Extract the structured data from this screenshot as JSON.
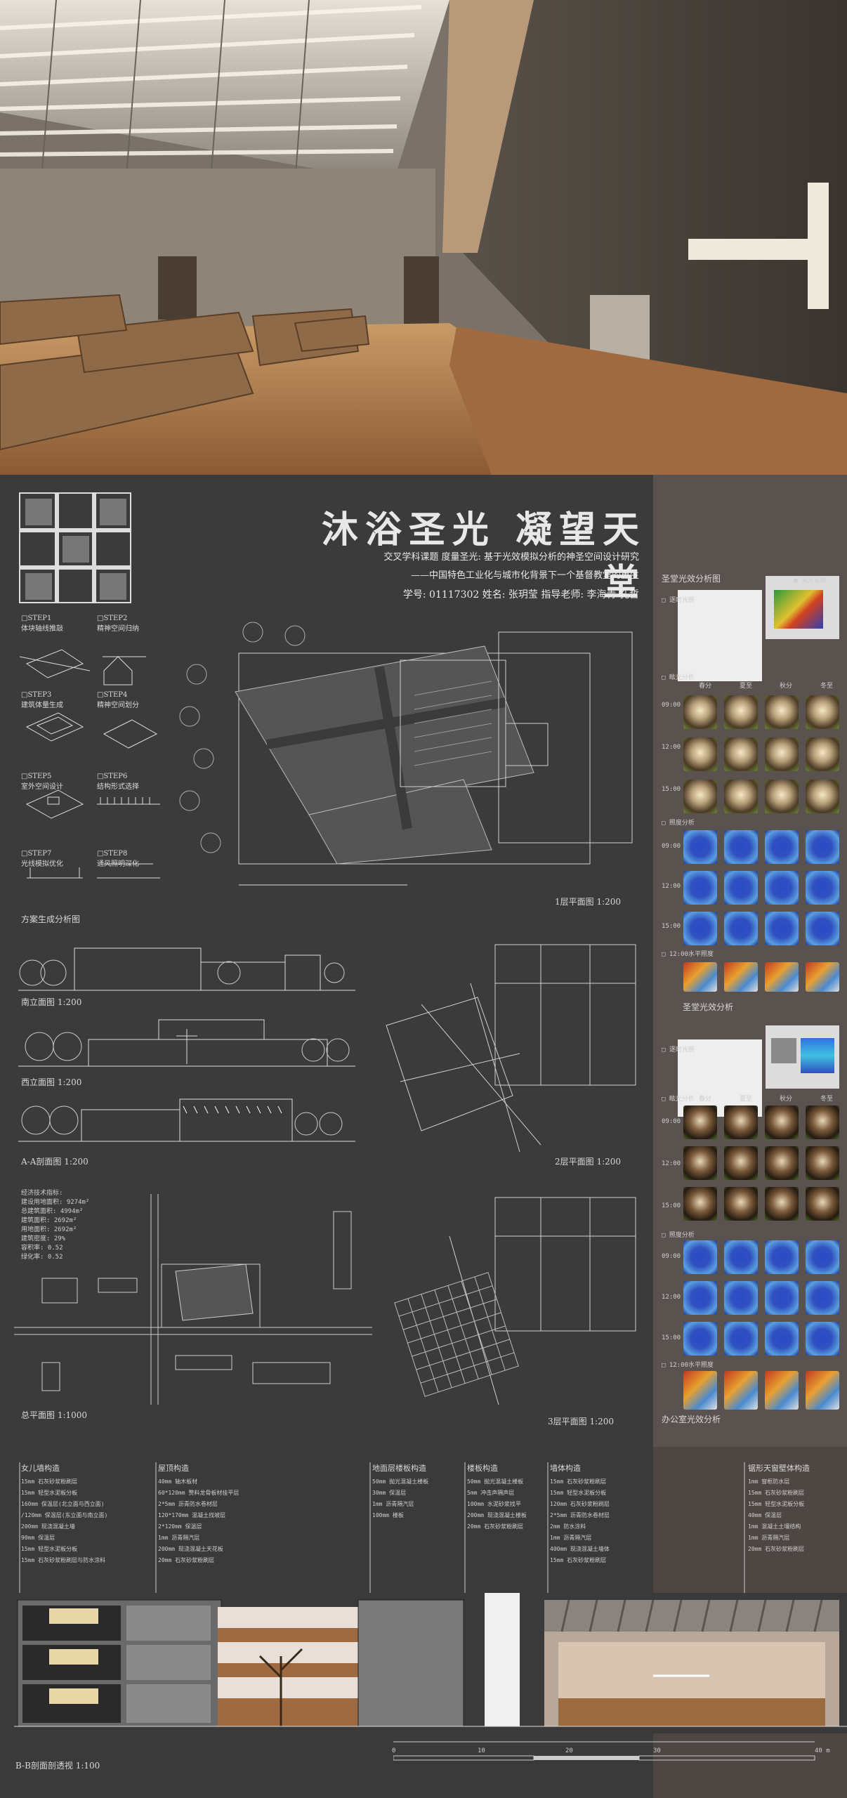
{
  "title": {
    "main": "沐浴圣光 凝望天堂",
    "line1": "交叉学科课题  度量圣光: 基于光效模拟分析的神圣空间设计研究",
    "line2": "——中国特色工业化与城市化背景下一个基督教堂的重生",
    "line3": "学号: 01117302  姓名: 张玥莹  指导老师: 李海青 孔哲"
  },
  "steps": [
    {
      "id": "STEP1",
      "label": "体块轴线推敲"
    },
    {
      "id": "STEP2",
      "label": "精神空间归纳"
    },
    {
      "id": "STEP3",
      "label": "建筑体量生成"
    },
    {
      "id": "STEP4",
      "label": "精神空间划分"
    },
    {
      "id": "STEP5",
      "label": "室外空间设计"
    },
    {
      "id": "STEP6",
      "label": "结构形式选择"
    },
    {
      "id": "STEP7",
      "label": "光线模拟优化"
    },
    {
      "id": "STEP8",
      "label": "通风照明深化"
    }
  ],
  "section_labels": {
    "scheme": "方案生成分析图",
    "south": "南立面图 1:200",
    "west": "西立面图 1:200",
    "aa": "A-A剖面图 1:200",
    "site": "总平面图 1:1000",
    "plan1": "1层平面图 1:200",
    "plan2": "2层平面图 1:200",
    "plan3": "3层平面图 1:200",
    "bb": "B-B剖面剖透视 1:100"
  },
  "stats": [
    "经济技术指标:",
    "建设用地面积: 9274m²",
    "总建筑面积: 4994m²",
    "建筑面积: 2692m²",
    "用地面积: 2692m²",
    "建筑密度: 29%",
    "容积率: 0.52",
    "绿化率: 0.52"
  ],
  "light": {
    "church_title": "圣堂光效分析图",
    "church_bottom": "圣堂光效分析",
    "office_bottom": "办公室光效分析",
    "legend": "■ 采光系数",
    "sub1": "□ 逐时光照",
    "sub2": "□ 眩光分析",
    "sub3": "□ 照度分析",
    "sub4": "□ 12:00水平照度",
    "seasons": [
      "春分",
      "夏至",
      "秋分",
      "冬至"
    ],
    "times": [
      "09:00",
      "12:00",
      "15:00"
    ]
  },
  "details": {
    "cols": [
      {
        "title": "女儿墙构造",
        "rows": [
          "15mm  石灰砂浆粉刷层",
          "15mm  轻型水泥板分板",
          "160mm 保温层(北立面与西立面)",
          "/120mm 保温层(东立面与南立面)",
          "200mm 现浇混凝土墙",
          "90mm  保温层",
          "15mm  轻型水泥板分板",
          "15mm  石灰砂浆粉刷层与防水涂料"
        ]
      },
      {
        "title": "屋顶构造",
        "rows": [
          "40mm  轴木板材",
          "60*120mm 赘料龙骨板材挂平层",
          "2*5mm 沥青防水卷材层",
          "120*170mm 混凝土找坡层",
          "2*120mm 保温层",
          "1mm   沥青隔汽层",
          "200mm 现浇混凝土天花板",
          "20mm  石灰砂浆粉刷层"
        ]
      },
      {
        "title": "地面层楼板构造",
        "rows": [
          "50mm  抛光混凝土楼板",
          "30mm  保温层",
          "1mm   沥青隔汽层",
          "100mm 楼板"
        ]
      },
      {
        "title": "楼板构造",
        "rows": [
          "50mm  抛光混凝土楼板",
          "5mm   冲击声隔声层",
          "100mm 水泥砂浆找平",
          "200mm 现浇混凝土楼板",
          "20mm  石灰砂浆粉刷层"
        ]
      },
      {
        "title": "墙体构造",
        "rows": [
          "15mm  石灰砂浆粉刷层",
          "15mm  轻型水泥板分板",
          "120mm 石灰砂浆粉刷层",
          "2*5mm 沥青防水卷材层",
          "2mm   防水涂料",
          "1mm   沥青隔汽层",
          "400mm 现浇混凝土墙体",
          "15mm  石灰砂浆粉刷层"
        ]
      },
      {
        "title": "锯形天窗壁体构造",
        "rows": [
          "1mm   窗框防水层",
          "15mm  石灰砂浆粉刷层",
          "15mm  轻型水泥板分板",
          "40mm  保温层",
          "1mm   混凝土土壤结构",
          "1mm   沥青隔汽层",
          "20mm  石灰砂浆粉刷层"
        ]
      }
    ]
  },
  "scale": [
    "0",
    "10",
    "20",
    "30",
    "40 m"
  ],
  "plan_scale": [
    "0",
    "10",
    "20",
    "30",
    "40"
  ]
}
